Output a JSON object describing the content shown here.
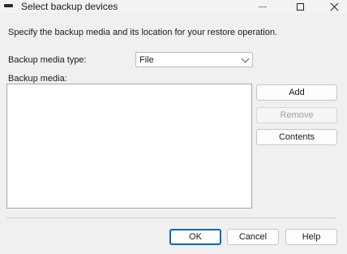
{
  "window": {
    "title": "Select backup devices",
    "controls": {
      "minimize": "minimize",
      "maximize": "maximize",
      "close": "close"
    }
  },
  "instructions": "Specify the backup media and its location for your restore operation.",
  "media_type": {
    "label": "Backup media type:",
    "selected": "File"
  },
  "media_list": {
    "label": "Backup media:",
    "items": []
  },
  "side_buttons": {
    "add": "Add",
    "remove": "Remove",
    "contents": "Contents"
  },
  "footer": {
    "ok": "OK",
    "cancel": "Cancel",
    "help": "Help"
  },
  "colors": {
    "accent": "#0067c0",
    "background": "#f0f0f0"
  }
}
